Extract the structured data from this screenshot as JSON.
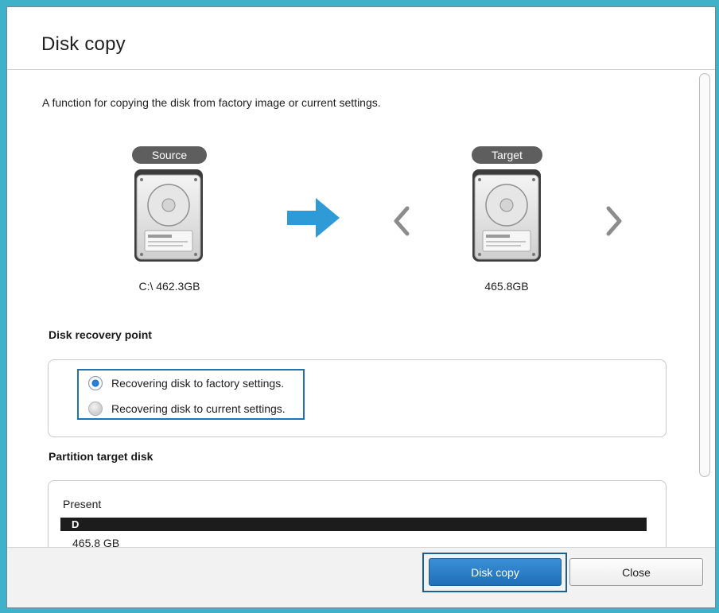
{
  "window": {
    "title": "Disk copy"
  },
  "main": {
    "description": "A function for copying the disk from factory image or current settings.",
    "source": {
      "tag": "Source",
      "label": "C:\\ 462.3GB"
    },
    "target": {
      "tag": "Target",
      "label": "465.8GB"
    }
  },
  "recovery": {
    "heading": "Disk recovery point",
    "options": [
      {
        "label": "Recovering disk to factory settings.",
        "selected": true
      },
      {
        "label": "Recovering disk to current settings.",
        "selected": false
      }
    ]
  },
  "partition": {
    "heading": "Partition target disk",
    "present_label": "Present",
    "partition_name": "D",
    "partition_size": "465.8 GB"
  },
  "footer": {
    "primary_label": "Disk copy",
    "close_label": "Close"
  },
  "colors": {
    "accent": "#1f6fb9",
    "frame": "#3fb1c8",
    "arrow": "#2e9ad6"
  },
  "icons": {
    "source_disk": "hard-drive-icon",
    "target_disk": "hard-drive-icon",
    "copy_arrow": "arrow-right-icon",
    "prev": "chevron-left-icon",
    "next": "chevron-right-icon"
  }
}
